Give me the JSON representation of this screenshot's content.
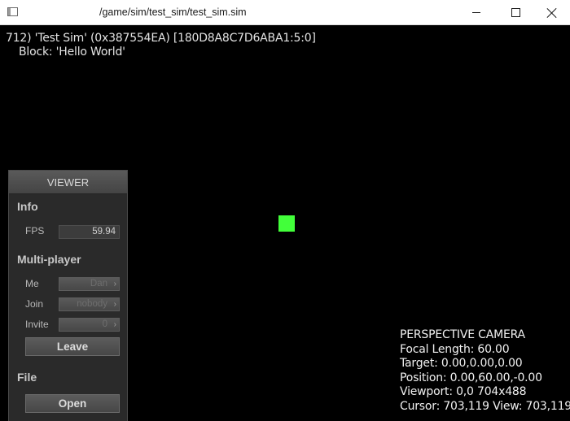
{
  "window": {
    "title": "/game/sim/test_sim/test_sim.sim"
  },
  "debug": {
    "line1": "712) 'Test Sim' (0x387554EA)  [180D8A8C7D6ABA1:5:0]",
    "line2": "Block: 'Hello World'"
  },
  "scene": {
    "block_color": "#42ff3a"
  },
  "camera": {
    "title": "PERSPECTIVE CAMERA",
    "focal_length": "Focal Length: 60.00",
    "target": "Target: 0.00,0.00,0.00",
    "position": "Position: 0.00,60.00,-0.00",
    "viewport": "Viewport: 0,0 704x488",
    "cursor": "Cursor: 703,119 View: 703,119"
  },
  "viewer": {
    "header": "VIEWER",
    "info": {
      "title": "Info",
      "fps_label": "FPS",
      "fps_value": "59.94"
    },
    "multiplayer": {
      "title": "Multi-player",
      "me_label": "Me",
      "me_value": "Dan",
      "join_label": "Join",
      "join_value": "nobody",
      "invite_label": "Invite",
      "invite_value": "0",
      "leave_label": "Leave"
    },
    "file": {
      "title": "File",
      "open_label": "Open"
    }
  },
  "icons": {
    "app": "window-icon",
    "minimize": "minimize-icon",
    "maximize": "maximize-icon",
    "close": "close-icon",
    "dropdown": "chevron-right-icon"
  }
}
